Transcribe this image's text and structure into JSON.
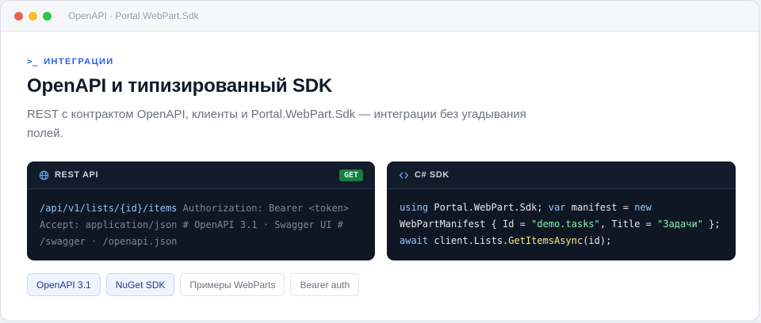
{
  "window": {
    "title": "OpenAPI · Portal.WebPart.Sdk"
  },
  "header": {
    "eyebrow": "ИНТЕГРАЦИИ",
    "title": "OpenAPI и типизированный SDK",
    "subtitle": "REST с контрактом OpenAPI, клиенты и Portal.WebPart.Sdk — интеграции без угадывания полей."
  },
  "rest_panel": {
    "label": "REST API",
    "method": "GET",
    "code": {
      "path": "/api/v1/lists/{id}/items",
      "rest": " Authorization: Bearer <token> Accept: application/json # OpenAPI 3.1 · Swagger UI # /swagger · /openapi.json"
    }
  },
  "sdk_panel": {
    "label": "C# SDK",
    "code": {
      "k_using": "using",
      "t1": " Portal.WebPart.Sdk; ",
      "k_var": "var",
      "t2": " manifest = ",
      "k_new": "new",
      "t3": " WebPartManifest { Id = ",
      "s_id": "\"demo.tasks\"",
      "t4": ", Title = ",
      "s_title": "\"Задачи\"",
      "t5": " }; ",
      "k_await": "await",
      "t6": " client.Lists.",
      "fn": "GetItemsAsync",
      "t7": "(id);"
    }
  },
  "tags": [
    {
      "label": "OpenAPI 3.1"
    },
    {
      "label": "NuGet SDK"
    },
    {
      "label": "Примеры WebParts"
    },
    {
      "label": "Bearer auth"
    }
  ],
  "colors": {
    "accent": "#2563eb",
    "code_bg": "#0f1724",
    "badge_green": "#15803d",
    "string": "#86efac",
    "function": "#fde68a"
  }
}
